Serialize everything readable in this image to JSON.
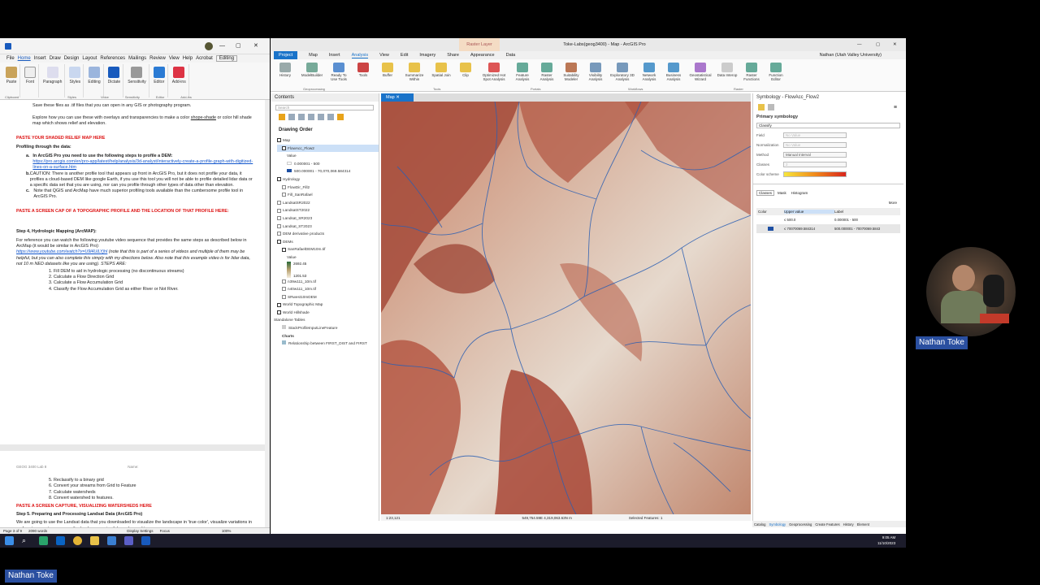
{
  "word": {
    "menu": [
      "File",
      "Home",
      "Insert",
      "Draw",
      "Design",
      "Layout",
      "References",
      "Mailings",
      "Review",
      "View",
      "Help",
      "Acrobat"
    ],
    "editing_label": "Editing",
    "ribbon": [
      "Paste",
      "Font",
      "Paragraph",
      "Styles",
      "Editing",
      "Dictate",
      "Sensitivity",
      "Editor",
      "Add-ins"
    ],
    "ribbon_groups": [
      "Clipboard",
      "Styles",
      "Voice",
      "Sensitivity",
      "Editor",
      "Add-ins"
    ],
    "p1": "Save these files as .tif files that you can open in any GIS or photography program.",
    "p2a": "Explore how you can use these with overlays and transparencies to make a color ",
    "p2b": "shope-shade",
    "p2c": " or color hill shade map which shows relief and elevation.",
    "h_shaded": "PASTE YOUR SHADED RELIEF MAP HERE",
    "h_profiling": "Profiling through the data:",
    "la_label": "a.",
    "la_text": "In ArcGIS Pro you need to use the following steps to profile a DEM:",
    "la_link": "https://pro.arcgis.com/en/pro-app/latest/help/analysis/3d-analyst/interactively-create-a-profile-graph-with-digitized-lines-on-a-surface.htm",
    "lb_label": "b.",
    "lb_text": "CAUTION: There is another profile tool that appears up front in ArcGIS Pro, but it does not profile your data, it profiles a cloud-based DEM like google Earth, if you use this tool you will not be able to profile detailed lidar data or a specific data set that you are using, nor can you profile through other types of data other than elevation.",
    "lc_label": "c.",
    "lc_text": "Note that QGIS and ArcMap have much superior profiling tools available than the cumbersome profile tool in ArcGIS Pro.",
    "h_topo": "PASTE A SCREEN CAP OF A TOPOGRAPHIC PROFILE AND THE LOCATION OF THAT PROFILE HERE:",
    "h_step4": "Step 4, Hydrologic Mapping (ArcMAP):",
    "p_ref": "For reference you can watch the following youtube video sequence that provides the same steps as described below in ArcMap (it would be similar in ArcGIS Pro):",
    "p_link": "https://www.youtube.com/watch?v=U9l4UiLYjhI",
    "p_note": " (note that this is part of a series of videos and multiple of them may be helpful, but you can also complete this simply with my directions below. Also note that this example video is for lidar data, not 10 m NED datasets like you are using). STEPS ARE:",
    "steps1": [
      "1.  Fill DEM to aid in hydrologic processing (no discontinuous streams)",
      "2.  Calculate a Flow Direction Grid",
      "3.  Calculate a Flow Accumulation Grid",
      "4.  Classify the Flow Accumulation Grid as either River or Not River."
    ],
    "header2": "GEOG 3400 Lab 8",
    "header2_name": "Name:",
    "steps2": [
      "5.  Reclassify to a binary grid",
      "6.  Convert your streams from Grid to Feature",
      "7.  Calculate watersheds",
      "8.  Convert watershed to features."
    ],
    "h_watersheds": "PASTE A SCREEN CAPTURE, VISUALIZING WATERSHEDS HERE",
    "h_step5": "Step 5. Preparing and Processing Landsat Data (ArcGIS Pro)",
    "p_landsat": "We are going to use the Landsat data that you downloaded to visualize the landscape in 'true color', visualize variations in surface temperatures across the landscape using false color, and to",
    "status_page": "Page 3 of 9",
    "status_words": "2090 words",
    "status_display": "Display Settings",
    "status_focus": "Focus",
    "status_zoom": "100%"
  },
  "arcgis": {
    "title": "Toke-Labs(geog3400) - Map - ArcGIS Pro",
    "user": "Nathan (Utah Valley University)",
    "raster_layer": "Raster Layer",
    "tabs": [
      "Project",
      "Map",
      "Insert",
      "Analysis",
      "View",
      "Edit",
      "Imagery",
      "Share",
      "Appearance",
      "Data"
    ],
    "tools": [
      [
        "History",
        ""
      ],
      [
        "ModelBuilder",
        ""
      ],
      [
        "Ready To Use Tools",
        ""
      ],
      [
        "Tools",
        ""
      ],
      [
        "Buffer",
        ""
      ],
      [
        "Summarize Within",
        ""
      ],
      [
        "Spatial Join",
        ""
      ],
      [
        "Clip",
        ""
      ],
      [
        "Optimized Hot Spot Analysis",
        ""
      ],
      [
        "Feature Analysis",
        ""
      ],
      [
        "Raster Analysis",
        ""
      ],
      [
        "Suitability Modeler",
        ""
      ],
      [
        "Visibility Analysis",
        ""
      ],
      [
        "Exploratory 3D Analysis",
        ""
      ],
      [
        "Network Analysis",
        ""
      ],
      [
        "Business Analysis",
        ""
      ],
      [
        "Geostatistical Wizard",
        ""
      ],
      [
        "Data Interop",
        ""
      ],
      [
        "Raster Functions",
        ""
      ],
      [
        "Function Editor",
        ""
      ]
    ],
    "groups": [
      "Geoprocessing",
      "Tools",
      "Portals",
      "Workflows",
      "Raster"
    ],
    "contents_title": "Contents",
    "search_placeholder": "Search",
    "drawing_order": "Drawing Order",
    "layers": [
      "Map",
      "FlowAcc_Flow2",
      "Value",
      "0.000001 - 500",
      "500.000001 - 70,070,069.584314",
      "Hydrology",
      "FlowDir_Fill2",
      "Fill_SanRafael",
      "LandsatSR2022",
      "LandsatST2022",
      "Landsat_SR2023",
      "Landsat_ST2023",
      "DEM derivative products",
      "DEMs",
      "SanRafaelDEM10m.tif",
      "Value",
      "2692.45",
      "1201.53",
      "n39w111_10m.tif",
      "n40w111_10m.tif",
      "SRwest10mDEM",
      "World Topographic Map",
      "World Hillshade",
      "Standalone Tables",
      "StackProfileInputLineFeature",
      "Charts",
      "Relationship between FIRST_DIST and FIRST"
    ],
    "map_tab": "Map",
    "scale": "1:23,121",
    "coords": "549,754.59E 4,319,063.63N m",
    "selected": "Selected Features: 1",
    "sym_title": "Symbology - FlowAcc_Flow2",
    "primary_sym": "Primary symbology",
    "classify": "Classify",
    "field_label": "Field",
    "field_value": "No Value",
    "norm_label": "Normalization",
    "norm_value": "No Value",
    "method_label": "Method",
    "method_value": "Manual Interval",
    "classes_label": "Classes",
    "classes_value": "2",
    "color_scheme_label": "Color scheme",
    "sym_tabs": [
      "Classes",
      "Mask",
      "Histogram"
    ],
    "more": "More",
    "table_headers": [
      "Color",
      "Upper value",
      "Label"
    ],
    "table_rows": [
      [
        "≤ 500.0",
        "0.000001 - 500"
      ],
      [
        "≤ 70070069.584314",
        "500.000001 - 70070069.5843"
      ]
    ],
    "bottom_tabs": [
      "Catalog",
      "Symbology",
      "Geoprocessing",
      "Create Features",
      "History",
      "Element"
    ],
    "time": "9:05 AM",
    "date": "11/10/2023"
  },
  "people": {
    "presenter": "Nathan Toke",
    "viewer": "Nathan Toke"
  },
  "colors": {
    "arc_blue": "#1a73c9",
    "red_heading": "#dd1111",
    "name_tag": "#2a4fa0"
  }
}
